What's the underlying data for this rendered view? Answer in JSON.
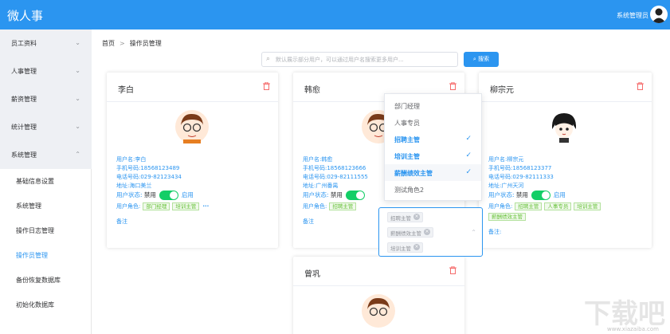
{
  "header": {
    "title": "微人事",
    "user": "系统管理员"
  },
  "sidebar": {
    "groups": [
      "员工资料",
      "人事管理",
      "薪资管理",
      "统计管理",
      "系统管理"
    ],
    "items": [
      "基础信息设置",
      "系统管理",
      "操作日志管理",
      "操作员管理",
      "备份恢复数据库",
      "初始化数据库"
    ]
  },
  "breadcrumb": {
    "home": "首页",
    "current": "操作员管理"
  },
  "search": {
    "placeholder": "默认展示部分用户，可以通过用户名搜索更多用户...",
    "button": "搜索"
  },
  "cards": [
    {
      "name": "李白",
      "username": "用户名:李白",
      "phone": "手机号码:18568123489",
      "tel": "电话号码:029-82123434",
      "address": "地址:海口美兰",
      "status_label": "用户状态:",
      "disabled": "禁用",
      "enabled": "启用",
      "roles_label": "用户角色:",
      "roles": [
        "部门经理",
        "培训主管"
      ],
      "more": "···",
      "remark": "备注"
    },
    {
      "name": "韩愈",
      "username": "用户名:韩愈",
      "phone": "手机号码:18568123666",
      "tel": "电话号码:029-82111555",
      "address": "地址:广州番禺",
      "status_label": "用户状态:",
      "disabled": "禁用",
      "roles_label": "用户角色:",
      "roles": [
        "招聘主管"
      ],
      "remark": "备注"
    },
    {
      "name": "柳宗元",
      "username": "用户名:柳宗元",
      "phone": "手机号码:18568123377",
      "tel": "电话号码:029-82111333",
      "address": "地址:广州天河",
      "status_label": "用户状态:",
      "disabled": "禁用",
      "enabled": "启用",
      "roles_label": "用户角色:",
      "roles": [
        "招聘主管",
        "人事专员",
        "培训主管",
        "薪酬绩效主管"
      ],
      "remark": "备注:"
    },
    {
      "name": "曾巩"
    }
  ],
  "dropdown": {
    "options": [
      {
        "label": "部门经理",
        "selected": false
      },
      {
        "label": "人事专员",
        "selected": false
      },
      {
        "label": "招聘主管",
        "selected": true
      },
      {
        "label": "培训主管",
        "selected": true
      },
      {
        "label": "薪酬绩效主管",
        "selected": true
      },
      {
        "label": "测试角色2",
        "selected": false
      }
    ],
    "check": "✓"
  },
  "multiselect": {
    "tags": [
      "招聘主管",
      "薪酬绩效主管",
      "培训主管"
    ],
    "remove": "×"
  },
  "watermark": {
    "text": "下载吧",
    "url": "www.xiazaiba.com"
  },
  "colors": {
    "primary": "#2b95f0",
    "switch_on": "#13ce66",
    "tag_green": "#67c23a",
    "delete_red": "#f56c6c"
  }
}
